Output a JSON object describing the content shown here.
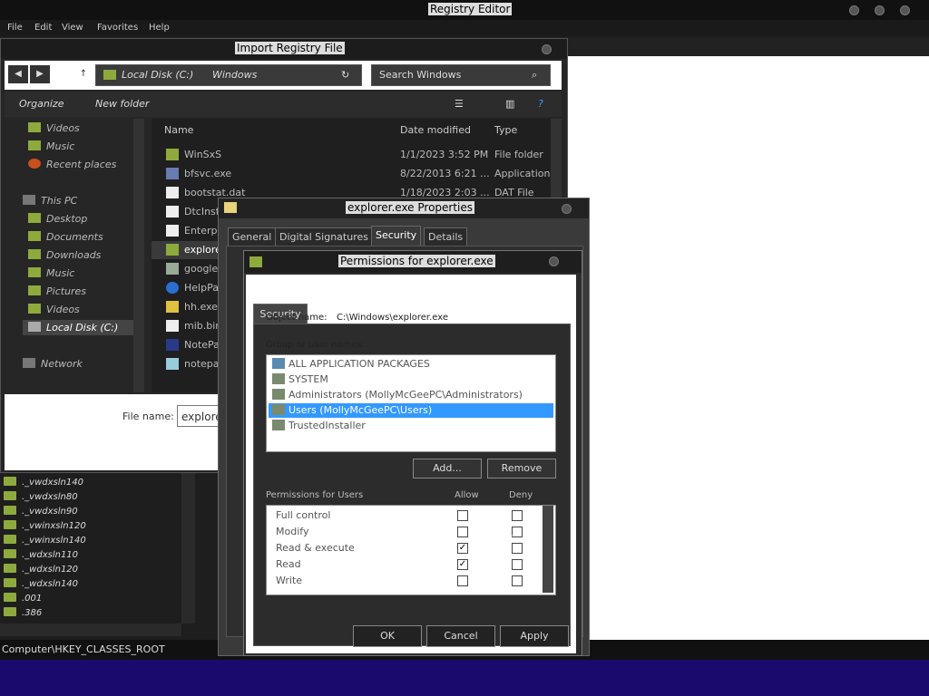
{
  "registry": {
    "title": "Registry Editor",
    "menu": [
      "File",
      "Edit",
      "View",
      "Favorites",
      "Help"
    ],
    "status_path": "Computer\\HKEY_CLASSES_ROOT",
    "tree_items": [
      "._vwdxsln140",
      "._vwdxsln80",
      "._vwdxsln90",
      "._vwinxsln120",
      "._vwinxsln140",
      "._wdxsln110",
      "._wdxsln120",
      "._wdxsln140",
      ".001",
      ".386"
    ]
  },
  "import_dialog": {
    "title": "Import Registry File",
    "address": [
      "Local Disk (C:)",
      "Windows"
    ],
    "search_placeholder": "Search Windows",
    "toolbar": {
      "organize": "Organize",
      "new_folder": "New folder"
    },
    "nav": [
      "Videos",
      "Music",
      "Recent places",
      "This PC",
      "Desktop",
      "Documents",
      "Downloads",
      "Music",
      "Pictures",
      "Videos",
      "Local Disk (C:)",
      "Network"
    ],
    "columns": {
      "name": "Name",
      "date": "Date modified",
      "type": "Type"
    },
    "files": [
      {
        "name": "WinSxS",
        "date": "1/1/2023 3:52 PM",
        "type": "File folder"
      },
      {
        "name": "bfsvc.exe",
        "date": "8/22/2013 6:21 ...",
        "type": "Application"
      },
      {
        "name": "bootstat.dat",
        "date": "1/18/2023 2:03 ...",
        "type": "DAT File"
      },
      {
        "name": "DtcInst",
        "date": "",
        "type": ""
      },
      {
        "name": "Enterp",
        "date": "",
        "type": ""
      },
      {
        "name": "explorer",
        "date": "",
        "type": ""
      },
      {
        "name": "google",
        "date": "",
        "type": ""
      },
      {
        "name": "HelpPa",
        "date": "",
        "type": ""
      },
      {
        "name": "hh.exe",
        "date": "",
        "type": ""
      },
      {
        "name": "mib.bin",
        "date": "",
        "type": ""
      },
      {
        "name": "NotePa",
        "date": "",
        "type": ""
      },
      {
        "name": "notepa",
        "date": "",
        "type": ""
      }
    ],
    "file_name_label": "File name:",
    "file_name_value": "explore"
  },
  "properties_dialog": {
    "title": "explorer.exe Properties",
    "tabs": [
      "General",
      "Digital Signatures",
      "Security",
      "Details"
    ],
    "selected_tab": "Security"
  },
  "permissions_dialog": {
    "title": "Permissions for explorer.exe",
    "tab": "Security",
    "object_name_label": "Object name:",
    "object_name_value": "C:\\Windows\\explorer.exe",
    "group_label": "Group or user names:",
    "groups": [
      "ALL APPLICATION PACKAGES",
      "SYSTEM",
      "Administrators (MollyMcGeePC\\Administrators)",
      "Users (MollyMcGeePC\\Users)",
      "TrustedInstaller"
    ],
    "selected_group_index": 3,
    "add_label": "Add...",
    "remove_label": "Remove",
    "permissions_for": "Permissions for Users",
    "allow_label": "Allow",
    "deny_label": "Deny",
    "permissions": [
      {
        "name": "Full control",
        "allow": false,
        "deny": false
      },
      {
        "name": "Modify",
        "allow": false,
        "deny": false
      },
      {
        "name": "Read & execute",
        "allow": true,
        "deny": false
      },
      {
        "name": "Read",
        "allow": true,
        "deny": false
      },
      {
        "name": "Write",
        "allow": false,
        "deny": false
      }
    ],
    "ok_label": "OK",
    "cancel_label": "Cancel",
    "apply_label": "Apply"
  },
  "colors": {
    "selection": "#3399ff",
    "folder": "#8faa3c",
    "taskbar": "#1a0a6e"
  }
}
